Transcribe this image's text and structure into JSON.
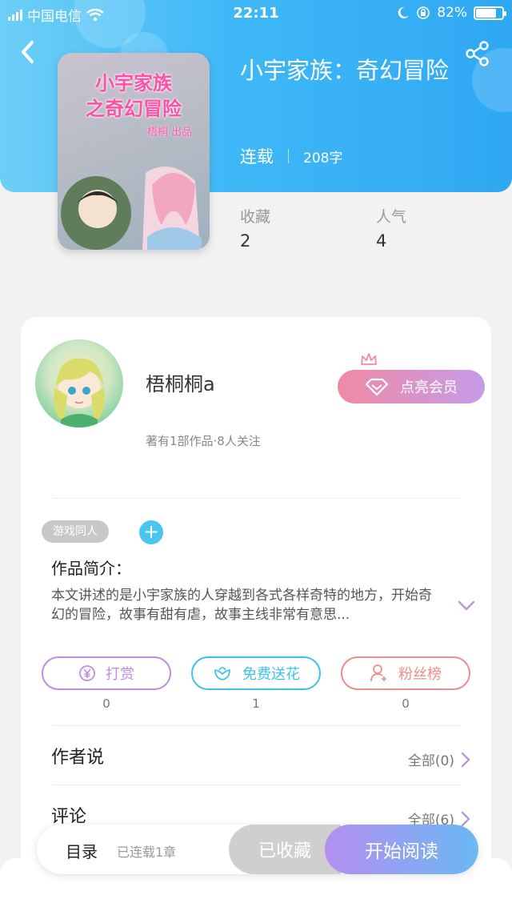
{
  "status_bar": {
    "carrier": "中国电信",
    "time": "22:11",
    "battery": "82%",
    "battery_level": 0.82
  },
  "book": {
    "title": "小宇家族：奇幻冒险",
    "status": "连载",
    "word_count": "208字",
    "cover_title_line1": "小宇家族",
    "cover_title_line2": "之奇幻冒险",
    "cover_subtitle": "梧桐 出品"
  },
  "stats": [
    {
      "label": "收藏",
      "value": "2"
    },
    {
      "label": "人气",
      "value": "4"
    }
  ],
  "author": {
    "name": "梧桐桐a",
    "info": "著有1部作品·8人关注",
    "vip_label": "点亮会员"
  },
  "tags": {
    "items": [
      "游戏同人"
    ],
    "add_symbol": "+"
  },
  "intro": {
    "title": "作品简介：",
    "text": "本文讲述的是小宇家族的人穿越到各式各样奇特的地方，开始奇幻的冒险，故事有甜有虐，故事主线非常有意思..."
  },
  "actions": [
    {
      "label": "打赏",
      "count": "0",
      "color": "#c28be6",
      "icon": "yen-icon"
    },
    {
      "label": "免费送花",
      "count": "1",
      "color": "#3ec3ea",
      "icon": "flower-icon"
    },
    {
      "label": "粉丝榜",
      "count": "0",
      "color": "#ef8c8c",
      "icon": "fan-user-icon"
    }
  ],
  "sections": {
    "author_says": {
      "title": "作者说",
      "more": "全部(0)"
    },
    "comments": {
      "title": "评论",
      "more": "全部(6)"
    }
  },
  "bottom": {
    "toc": "目录",
    "toc_sub": "已连载1章",
    "favorite": "已收藏",
    "read": "开始阅读"
  }
}
